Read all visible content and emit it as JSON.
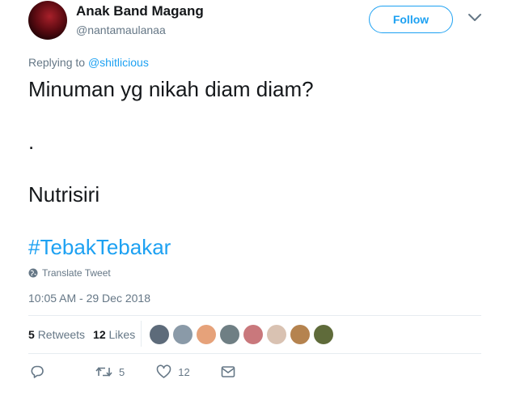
{
  "author": {
    "name": "Anak Band Magang",
    "handle": "@nantamaulanaa"
  },
  "follow_label": "Follow",
  "reply": {
    "prefix": "Replying to ",
    "user": "@shitlicious"
  },
  "tweet": {
    "text": "Minuman yg nikah diam diam?\n\n.\n\nNutrisiri\n\n",
    "hashtag": "#TebakTebakar"
  },
  "translate_label": "Translate Tweet",
  "timestamp": "10:05 AM - 29 Dec 2018",
  "stats": {
    "retweets": "5",
    "retweets_label": "Retweets",
    "likes": "12",
    "likes_label": "Likes"
  },
  "liker_colors": [
    "#5d6b7a",
    "#8a9aa8",
    "#e6a27a",
    "#6f7f84",
    "#c9787c",
    "#d9c2b2",
    "#b5834f",
    "#5f6b3a"
  ],
  "actions": {
    "retweet_count": "5",
    "like_count": "12"
  },
  "colors": {
    "accent": "#1da1f2",
    "secondary": "#657786",
    "text": "#14171a"
  }
}
